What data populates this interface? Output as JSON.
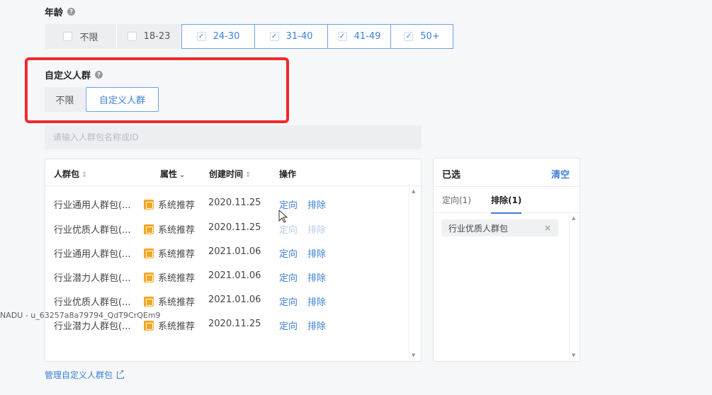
{
  "age": {
    "label": "年龄",
    "options": [
      {
        "label": "不限",
        "checked": false
      },
      {
        "label": "18-23",
        "checked": false
      },
      {
        "label": "24-30",
        "checked": true
      },
      {
        "label": "31-40",
        "checked": true
      },
      {
        "label": "41-49",
        "checked": true
      },
      {
        "label": "50+",
        "checked": true
      }
    ]
  },
  "custom_audience": {
    "label": "自定义人群",
    "option_none": "不限",
    "option_custom": "自定义人群",
    "selected": "自定义人群"
  },
  "search": {
    "placeholder": "请输入人群包名称或ID"
  },
  "table": {
    "headers": {
      "name": "人群包",
      "attr": "属性",
      "created": "创建时间",
      "ops": "操作"
    },
    "rows": [
      {
        "name": "行业通用人群包(...",
        "attr": "系统推荐",
        "date": "2020.11.25",
        "target": "定向",
        "exclude": "排除"
      },
      {
        "name": "行业优质人群包(...",
        "attr": "系统推荐",
        "date": "2020.11.25",
        "target": "定向",
        "exclude": "排除"
      },
      {
        "name": "行业通用人群包(...",
        "attr": "系统推荐",
        "date": "2021.01.06",
        "target": "定向",
        "exclude": "排除"
      },
      {
        "name": "行业潜力人群包(...",
        "attr": "系统推荐",
        "date": "2021.01.06",
        "target": "定向",
        "exclude": "排除"
      },
      {
        "name": "行业优质人群包(...",
        "attr": "系统推荐",
        "date": "2021.01.06",
        "target": "定向",
        "exclude": "排除"
      },
      {
        "name": "行业潜力人群包(...",
        "attr": "系统推荐",
        "date": "2020.11.25",
        "target": "定向",
        "exclude": "排除"
      }
    ]
  },
  "selected_panel": {
    "title": "已选",
    "clear": "清空",
    "tab_target": "定向(1)",
    "tab_exclude": "排除(1)",
    "tag": "行业优质人群包"
  },
  "manage_link": "管理自定义人群包",
  "watermark": "NADU - u_63257a8a79794_QdT9CrQEm9",
  "colors": {
    "accent": "#3d7fd8",
    "highlight_border": "#f02a2a",
    "badge": "#f5a623"
  }
}
